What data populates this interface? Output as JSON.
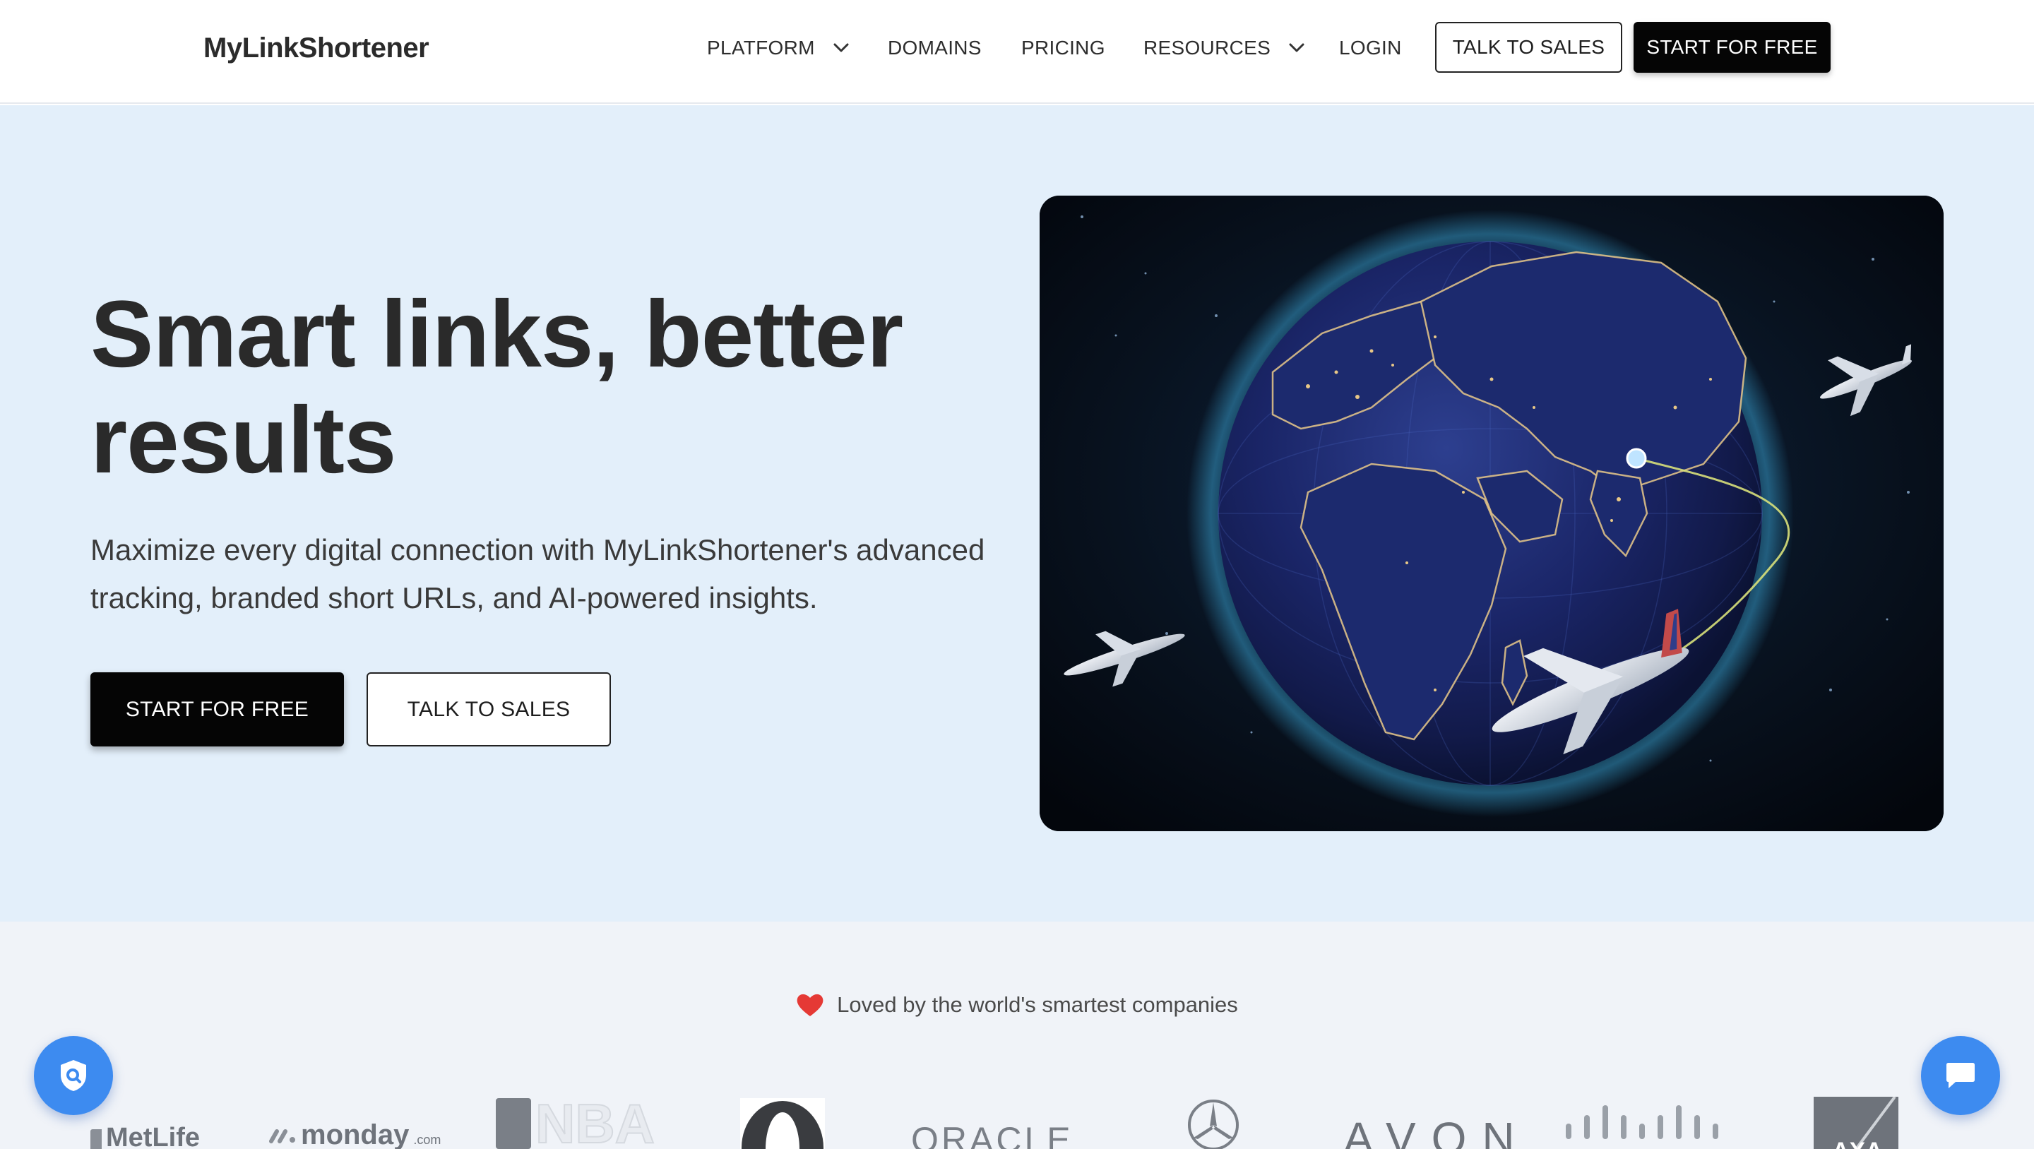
{
  "header": {
    "logo": "MyLinkShortener",
    "nav": {
      "platform": "PLATFORM",
      "domains": "DOMAINS",
      "pricing": "PRICING",
      "resources": "RESOURCES",
      "login": "LOGIN"
    },
    "talk_to_sales": "TALK TO SALES",
    "start_for_free": "START FOR FREE"
  },
  "hero": {
    "title": "Smart links, better results",
    "subtitle": "Maximize every digital connection with MyLinkShortener's advanced tracking, branded short URLs, and AI-powered insights.",
    "primary_cta": "START FOR FREE",
    "secondary_cta": "TALK TO SALES"
  },
  "logos": {
    "heading": "Loved by the world's smartest companies",
    "brands": {
      "metlife": "MetLife",
      "monday": "monday",
      "monday_suffix": ".com",
      "nba": "NBA",
      "oracle": "ORACLE",
      "avon": "AVON",
      "axa": "AXA"
    }
  },
  "colors": {
    "hero_bg": "#e3effa",
    "logos_bg": "#f0f3f8",
    "fab_blue": "#3d8bf0",
    "button_dark": "#050505"
  }
}
